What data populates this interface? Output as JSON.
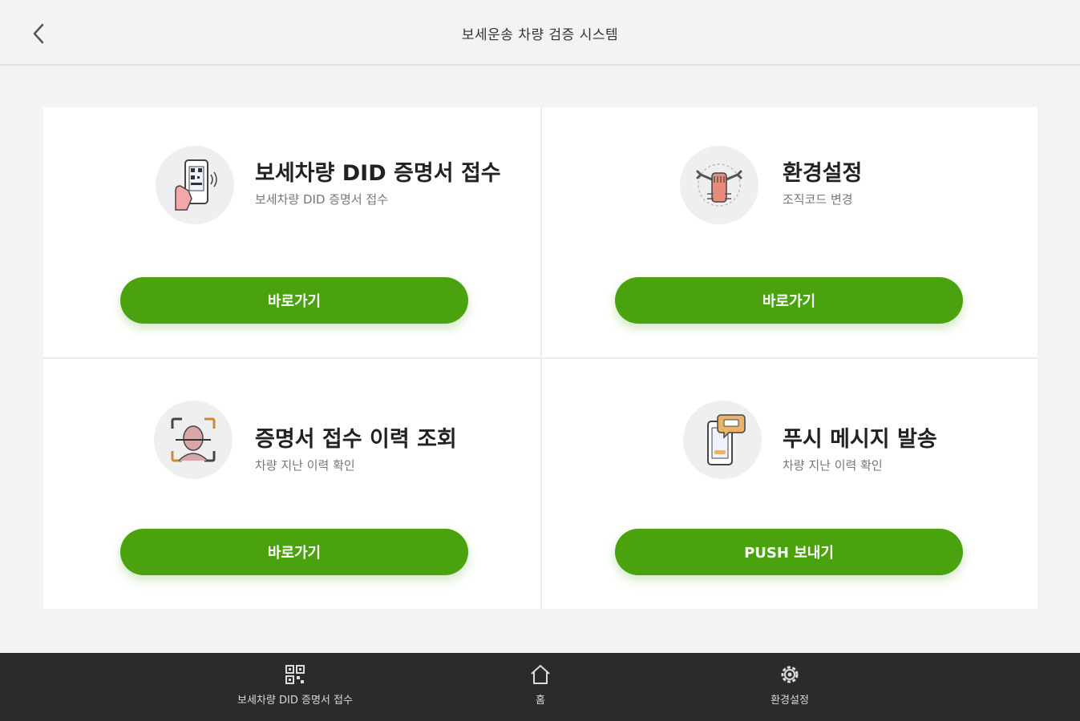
{
  "header": {
    "title": "보세운송 차량 검증 시스템",
    "back_icon": "chevron-left-icon"
  },
  "cards": [
    {
      "title": "보세차량 DID 증명서 접수",
      "subtitle": "보세차량 DID 증명서 접수",
      "button": "바로가기",
      "icon": "phone-qr-icon"
    },
    {
      "title": "환경설정",
      "subtitle": "조직코드 변경",
      "button": "바로가기",
      "icon": "settings-wrench-icon"
    },
    {
      "title": "증명서 접수 이력 조회",
      "subtitle": "차량 지난 이력 확인",
      "button": "바로가기",
      "icon": "face-scan-icon"
    },
    {
      "title": "푸시 메시지 발송",
      "subtitle": "차량 지난 이력 확인",
      "button": "PUSH 보내기",
      "icon": "phone-message-icon"
    }
  ],
  "bottom_nav": {
    "items": [
      {
        "label": "보세차량 DID 증명서 접수",
        "icon": "qr-code-icon"
      },
      {
        "label": "홈",
        "icon": "home-icon"
      },
      {
        "label": "환경설정",
        "icon": "gear-icon"
      }
    ]
  },
  "colors": {
    "accent": "#4aa30e",
    "background": "#f3f3f3",
    "nav_background": "#2b2b2b"
  }
}
